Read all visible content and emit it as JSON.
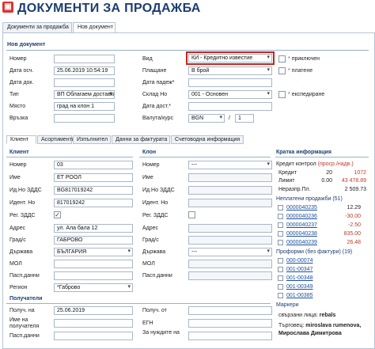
{
  "app_title": "ДОКУМЕНТИ ЗА ПРОДАЖБА",
  "tabs": [
    "Документи за продажба",
    "Нов документ"
  ],
  "section_new_doc": "Нов документ",
  "form": {
    "nomer_label": "Номер",
    "nomer_value": "",
    "data_osch_label": "Дата осч.",
    "data_osch_value": "25.06.2019 10:54:19",
    "data_dok_label": "Дата док.",
    "data_dok_value": "",
    "tip_label": "Тип",
    "tip_value": "ВП Облагаем доставки",
    "masto_label": "Място",
    "masto_value": "град на клон 1",
    "vrazka_label": "Връзка",
    "vrazka_value": "",
    "vid_label": "Вид",
    "vid_value": "КИ - Кредитно известие",
    "plashtane_label": "Плащане",
    "plashtane_value": "В брой",
    "data_padej_label": "Дата падеж*",
    "data_padej_value": "",
    "sklad_label": "Склад Но",
    "sklad_value": "001 - Основен",
    "data_dost_label": "Дата дост.*",
    "data_dost_value": "",
    "valuta_label": "Валута/курс",
    "valuta_value": "BGN",
    "kurs_value": "1",
    "priklyuchen": "приключен",
    "platene": "платене",
    "ekspedirane": "експедиране"
  },
  "subtabs": [
    "Клиент",
    "Асортименти",
    "Изпълнител",
    "Данни за фактурата",
    "Счетоводна информация"
  ],
  "client": {
    "header": "Клиент",
    "nomer_label": "Номер",
    "nomer_value": "03",
    "ime_label": "Име",
    "ime_value": "ЕТ РООЛ",
    "dds_label": "Ид.Но ЗДДС",
    "dds_value": "BG817019242",
    "ident_label": "Идент. Но",
    "ident_value": "817019242",
    "reg_label": "Рег. ЗДДС",
    "reg_checked": "✓",
    "adres_label": "Адрес",
    "adres_value": "ул. Ала бала 12",
    "grad_label": "Град/с",
    "grad_value": "ГАБРОВО",
    "darzhava_label": "Държава",
    "darzhava_value": "БЪЛГАРИЯ",
    "mol_label": "МОЛ",
    "mol_value": "",
    "pasp_label": "Пасп.данни",
    "pasp_value": "",
    "region_label": "Регион",
    "region_value": "*Габрово"
  },
  "klon": {
    "header": "Клон",
    "nomer_label": "Номер",
    "nomer_value": "---",
    "ime_label": "Име",
    "dds_label": "Ид.Но ЗДДС",
    "ident_label": "Идент. Но",
    "reg_label": "Рег. ЗДДС",
    "adres_label": "Адрес",
    "grad_label": "Град/с",
    "darzhava_label": "Държава",
    "darzhava_value": "---",
    "mol_label": "МОЛ",
    "pasp_label": "Пасп.данни"
  },
  "recipients": {
    "header": "Получатели",
    "poluch_na_label": "Получ. на",
    "poluch_na_value": "25.06.2019",
    "ime_na_label": "Име на получателя",
    "pasp_label": "Пасп.данни",
    "poluch_ot_label": "Получ. от",
    "egn_label": "ЕГН",
    "za_nuzhdite_label": "За нуждите на"
  },
  "info": {
    "header": "Кратка информация",
    "kredit_kontrol": "Кредит контрол",
    "kredit_kontrol_suffix": "(проср./надв.)",
    "rows": [
      {
        "label": "Кредит",
        "a": "20",
        "b": "1072"
      },
      {
        "label": "Лимит",
        "a": "0.00",
        "b": "43 478.89"
      },
      {
        "label": "Неразпр.Пл.",
        "a": "",
        "b": "2 509.73"
      }
    ],
    "unpaid_header": "Неплатени продажби (51)",
    "unpaid": [
      {
        "no": "0000040235",
        "val": "12.29"
      },
      {
        "no": "0000040236",
        "val": "-30.00"
      },
      {
        "no": "0000040237",
        "val": "-2.50"
      },
      {
        "no": "0000040238",
        "val": "835.00"
      },
      {
        "no": "0000040239",
        "val": "26.48"
      }
    ],
    "proforma_header": "Проформи (без фактури) (19)",
    "proformas": [
      "000-00074",
      "001-00347",
      "001-00348",
      "001-00349",
      "001-00385"
    ],
    "markers": "Маркери",
    "related_label": "свързани лица:",
    "related_value": "rebals",
    "traders_label": "Търговец:",
    "traders_value": "miroslava rumenova,",
    "traders_value2": "Мирослава Димитрова"
  },
  "colors": {
    "accent": "#1d3d6e",
    "highlight": "#d0211c"
  }
}
